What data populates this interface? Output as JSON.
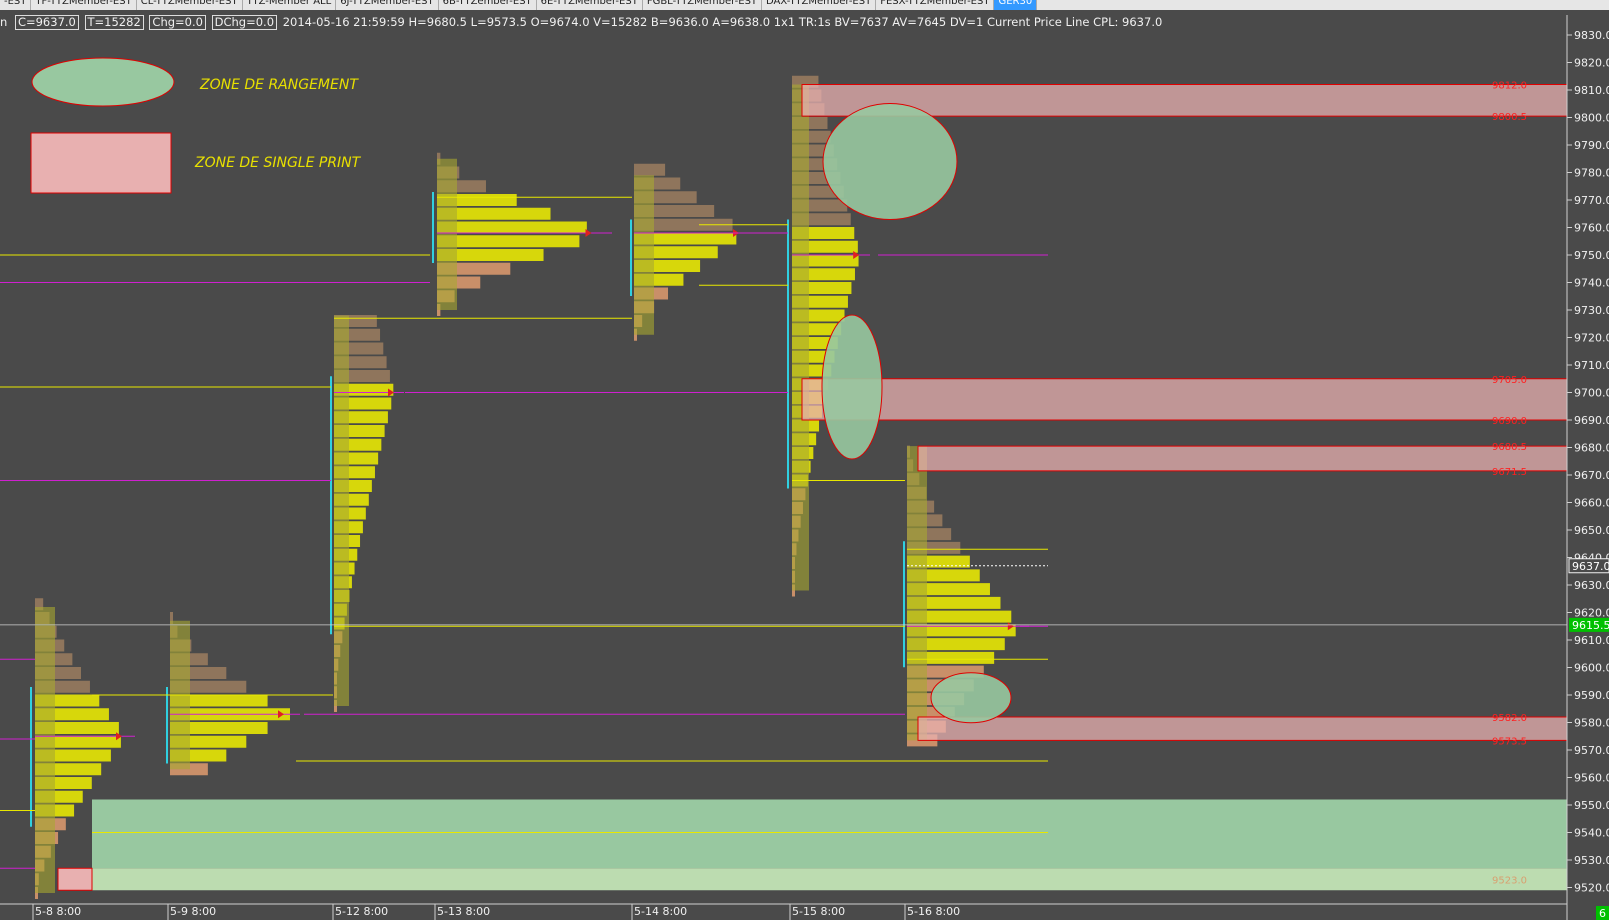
{
  "tabs": [
    {
      "label": "-EST",
      "active": false
    },
    {
      "label": "TF-TTZMember-EST",
      "active": false
    },
    {
      "label": "CL-TTZMember-EST",
      "active": false
    },
    {
      "label": "TTZ-Member ALL",
      "active": false
    },
    {
      "label": "6J-TTZMember-EST",
      "active": false
    },
    {
      "label": "6B-TTZember-EST",
      "active": false
    },
    {
      "label": "6E-TTZMember-EST",
      "active": false
    },
    {
      "label": "FGBL-TTZMember-EST",
      "active": false
    },
    {
      "label": "DAX-TTZMember-EST",
      "active": false
    },
    {
      "label": "FESX-TTZMember-EST",
      "active": false
    },
    {
      "label": "GER30",
      "active": true
    }
  ],
  "infobar": {
    "prefix": "n",
    "close": "C=9637.0",
    "ticks": "T=15282",
    "chg": "Chg=0.0",
    "dchg": "DChg=0.0",
    "details": "2014-05-16 21:59:59 H=9680.5 L=9573.5 O=9674.0 V=15282 B=9636.0 A=9638.0 1x1 TR:1s BV=7637 AV=7645 DV=1 Current Price Line  CPL: 9637.0"
  },
  "legend": {
    "range_zone": "ZONE DE RANGEMENT",
    "single_print_zone": "ZONE DE SINGLE PRINT"
  },
  "colors": {
    "background": "#4a4a4a",
    "profile_yellow": "#f0f000",
    "profile_olive": "#a8a830",
    "profile_orange": "#e8a070",
    "profile_brown": "#a08060",
    "vah_val_line": "#e8e800",
    "poc_line": "#d020d0",
    "value_area_bar": "#30d0e0",
    "single_print_fill": "#e8b0b0",
    "single_print_border": "#e00000",
    "range_zone_fill": "#98c8a0",
    "price_label": "#ff2020",
    "current_price_badge": "#00c000"
  },
  "price_axis": {
    "min": 9515,
    "max": 9833,
    "ticks": [
      "9830.0",
      "9820.0",
      "9810.0",
      "9800.0",
      "9790.0",
      "9780.0",
      "9770.0",
      "9760.0",
      "9750.0",
      "9740.0",
      "9730.0",
      "9720.0",
      "9710.0",
      "9700.0",
      "9690.0",
      "9680.0",
      "9670.0",
      "9660.0",
      "9650.0",
      "9640.0",
      "9630.0",
      "9620.0",
      "9610.0",
      "9600.0",
      "9590.0",
      "9580.0",
      "9570.0",
      "9560.0",
      "9550.0",
      "9540.0",
      "9530.0",
      "9520.0"
    ],
    "current_price": "9637.0",
    "marker_price": "9615.5",
    "corner_badge": "6"
  },
  "zone_labels": [
    {
      "text": "9812.0",
      "price": 9812
    },
    {
      "text": "9800.5",
      "price": 9800.5
    },
    {
      "text": "9705.0",
      "price": 9705
    },
    {
      "text": "9690.0",
      "price": 9690
    },
    {
      "text": "9680.5",
      "price": 9680.5
    },
    {
      "text": "9671.5",
      "price": 9671.5
    },
    {
      "text": "9582.0",
      "price": 9582
    },
    {
      "text": "9573.5",
      "price": 9573.5
    },
    {
      "text": "9523.0",
      "price": 9523
    }
  ],
  "sessions": [
    {
      "label": "5-8  8:00",
      "high": 9622,
      "low": 9518,
      "poc": 9575,
      "vah": 9590,
      "val": 9545
    },
    {
      "label": "5-9  8:00",
      "high": 9617,
      "low": 9563,
      "poc": 9583,
      "vah": 9590,
      "val": 9568
    },
    {
      "label": "5-12  8:00",
      "high": 9728,
      "low": 9586,
      "poc": 9700,
      "vah": 9703,
      "val": 9615
    },
    {
      "label": "5-13  8:00",
      "high": 9785,
      "low": 9730,
      "poc": 9758,
      "vah": 9770,
      "val": 9750
    },
    {
      "label": "5-14  8:00",
      "high": 9779,
      "low": 9721,
      "poc": 9758,
      "vah": 9760,
      "val": 9738
    },
    {
      "label": "5-15  8:00",
      "high": 9812,
      "low": 9628,
      "poc": 9750,
      "vah": 9760,
      "val": 9668
    },
    {
      "label": "5-16  8:00",
      "high": 9680.5,
      "low": 9573.5,
      "poc": 9615,
      "vah": 9643,
      "val": 9603
    }
  ]
}
